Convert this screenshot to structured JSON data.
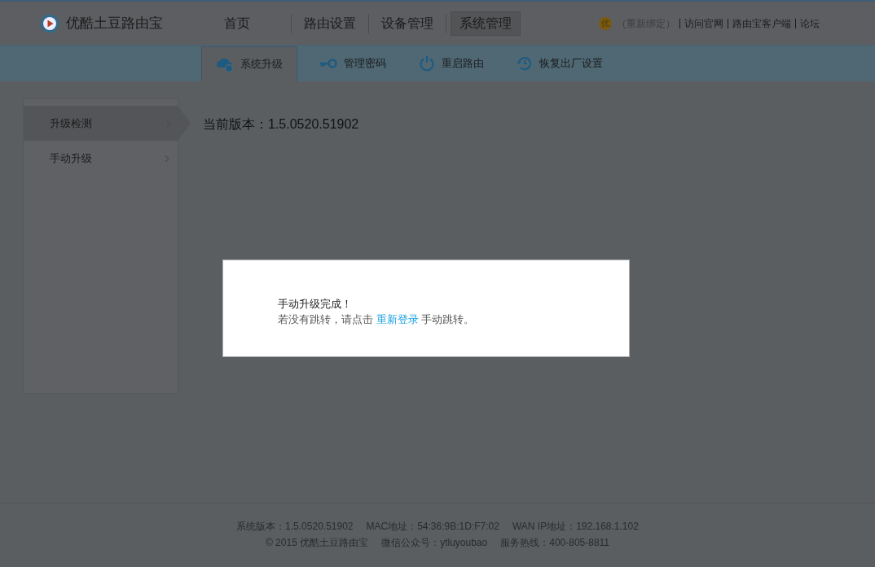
{
  "header": {
    "brand": "优酷土豆路由宝",
    "nav": [
      {
        "label": "首页",
        "selected": false
      },
      {
        "label": "路由设置",
        "selected": false
      },
      {
        "label": "设备管理",
        "selected": false
      },
      {
        "label": "系统管理",
        "selected": true
      }
    ],
    "account_badge": "优",
    "links": [
      "（重新绑定）",
      "访问官网",
      "路由宝客户端",
      "论坛"
    ]
  },
  "subnav": [
    {
      "label": "系统升级",
      "kind": "cloud",
      "selected": true
    },
    {
      "label": "管理密码",
      "kind": "key",
      "selected": false
    },
    {
      "label": "重启路由",
      "kind": "power",
      "selected": false
    },
    {
      "label": "恢复出厂设置",
      "kind": "history",
      "selected": false
    }
  ],
  "sidebar": {
    "items": [
      {
        "label": "升级检测",
        "selected": true
      },
      {
        "label": "手动升级",
        "selected": false
      }
    ]
  },
  "current_version": "当前版本：1.5.0520.51902",
  "dialog": {
    "title": "手动升级完成！",
    "before": "若没有跳转，请点击 ",
    "link": "重新登录",
    "after": " 手动跳转。"
  },
  "footer": {
    "lines": [
      [
        "系统版本：1.5.0520.51902",
        "MAC地址：54:36:9B:1D:F7:02",
        "WAN IP地址：192.168.1.102"
      ],
      [
        "© 2015 优酷土豆路由宝",
        "微信公众号：ytluyoubao",
        "服务热线：400-805-8811"
      ]
    ]
  }
}
